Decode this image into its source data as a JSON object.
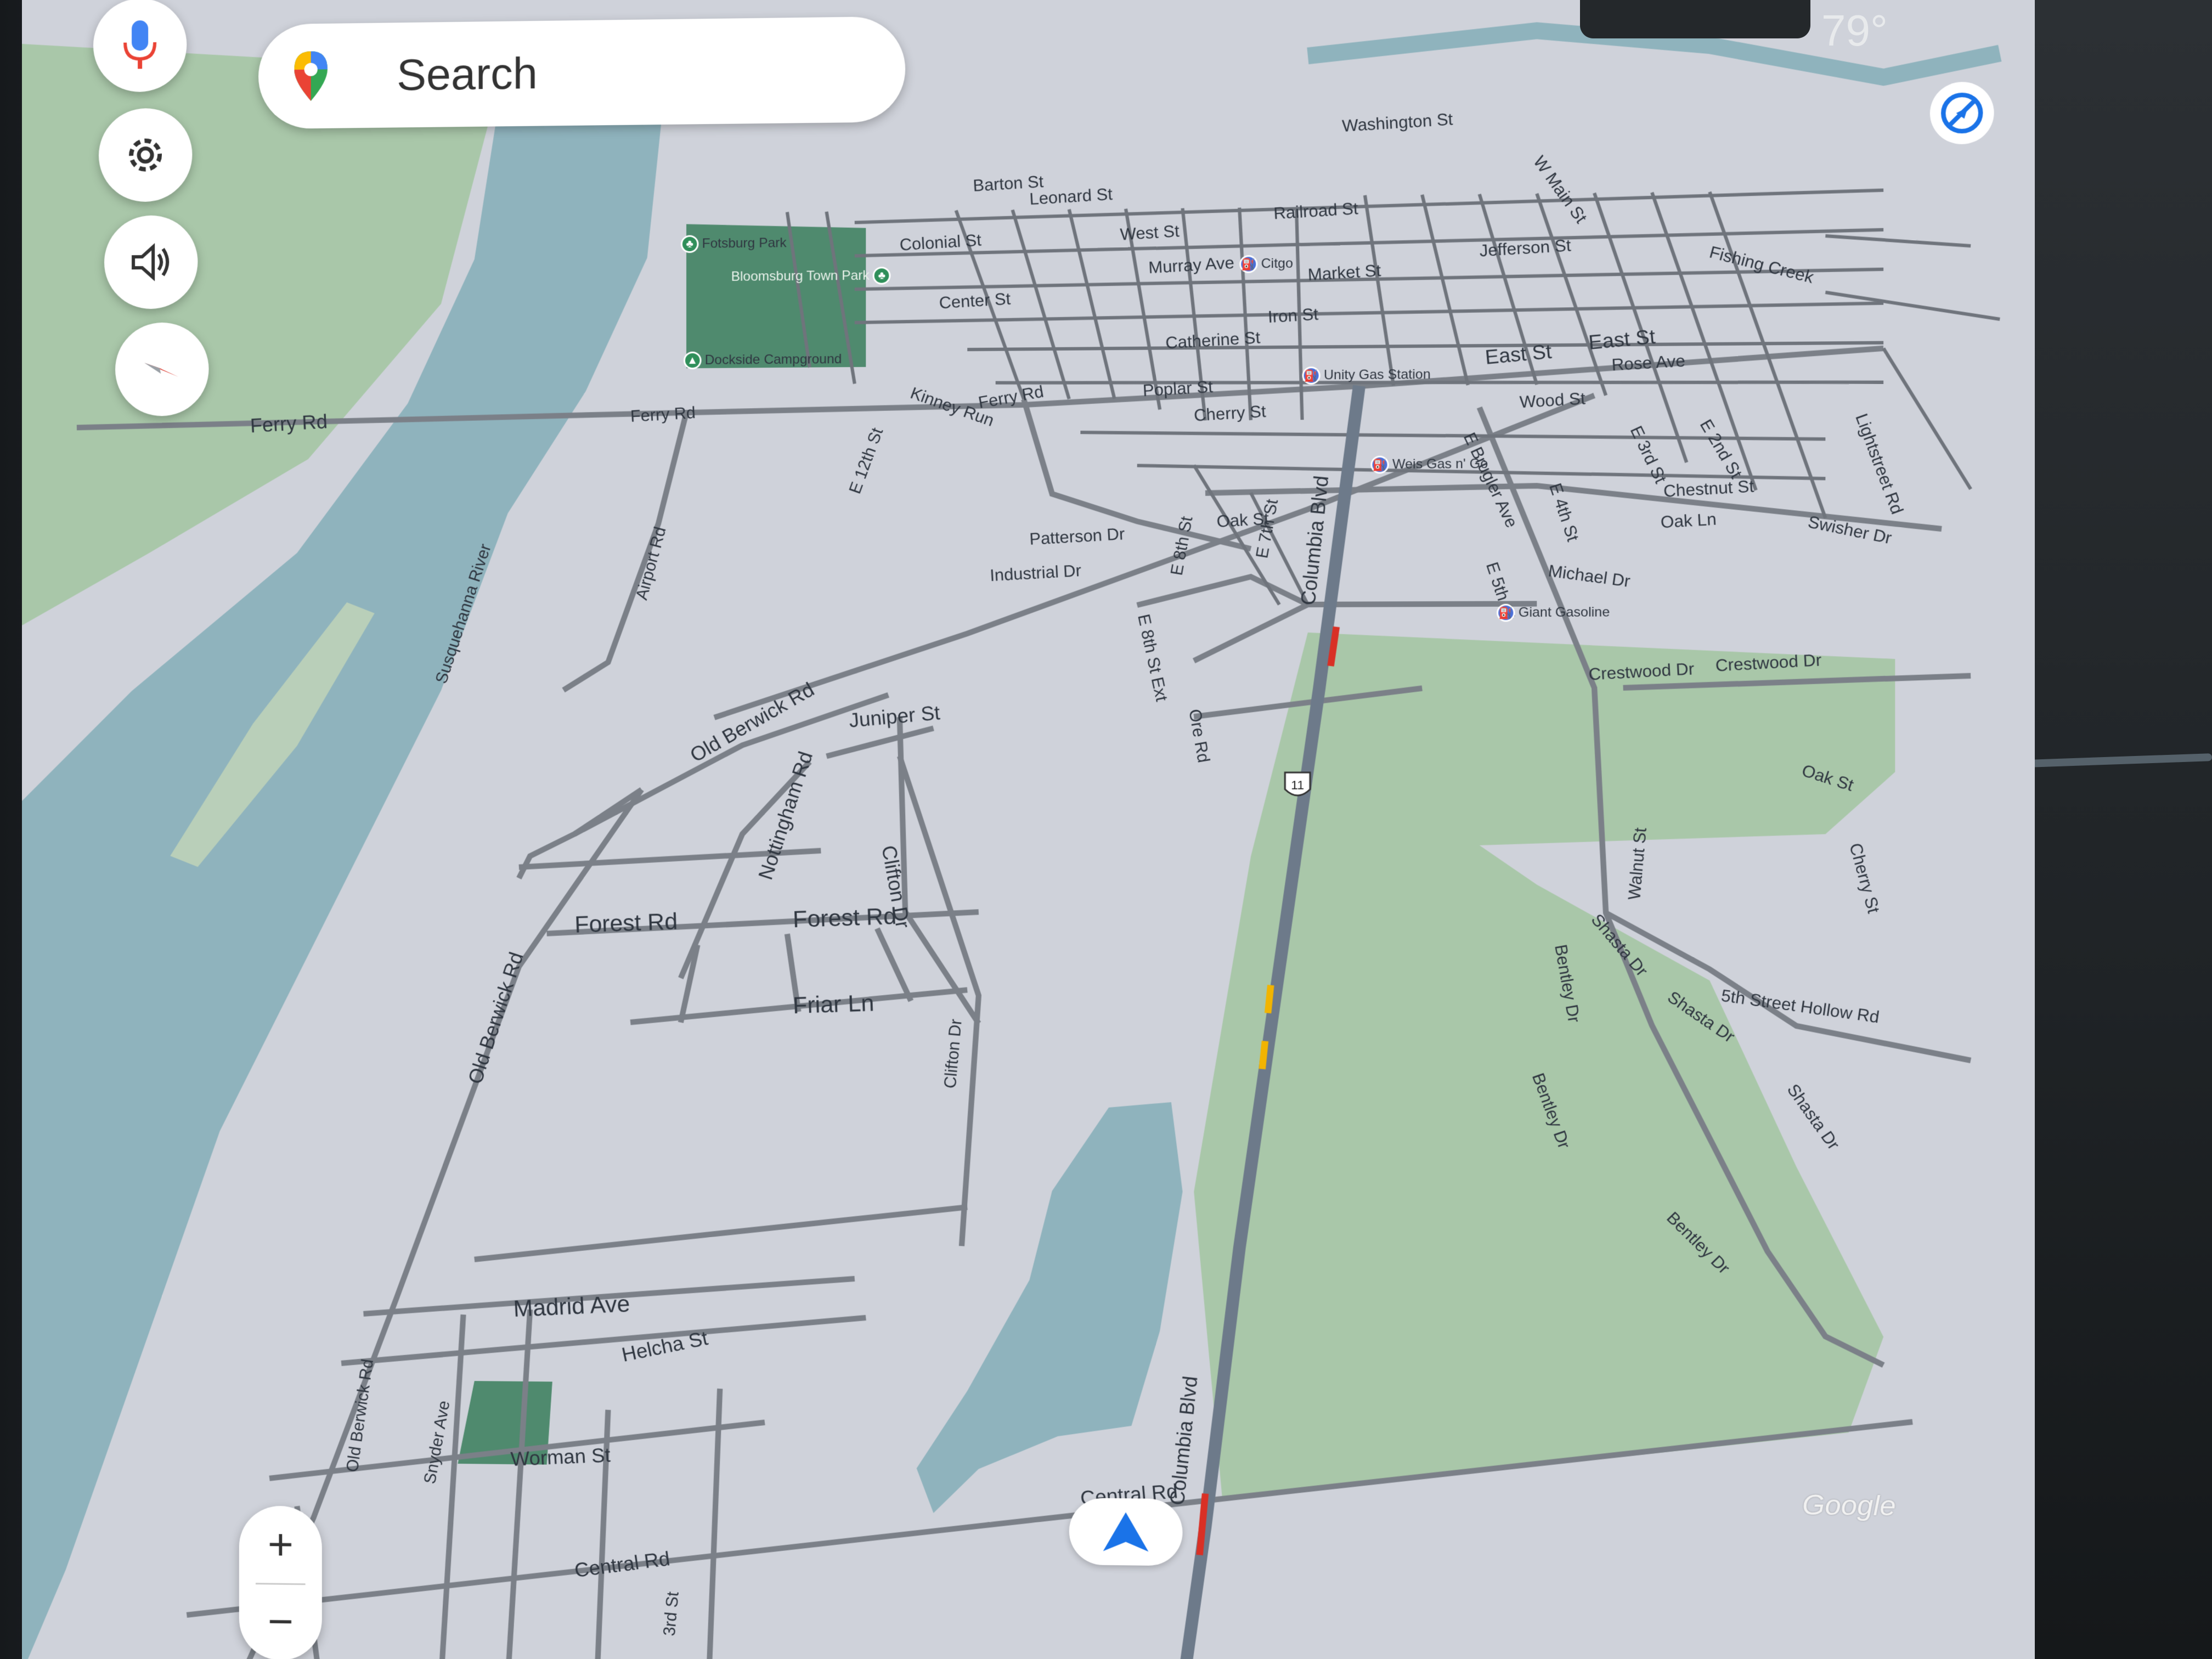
{
  "status": {
    "temperature": "79°"
  },
  "search": {
    "label": "Search"
  },
  "controls": {
    "mic": "mic-icon",
    "settings": "gear-icon",
    "volume": "volume-icon",
    "compass": "compass-icon",
    "zoom_in": "+",
    "zoom_out": "−"
  },
  "attribution": "Google",
  "colors": {
    "land": "#cfd2da",
    "river": "#8fb3bd",
    "park": "#a9c7a9",
    "park_dark": "#4f8a6e",
    "road": "#7b8088",
    "highway": "#6d7a8a",
    "traffic_red": "#d93025",
    "traffic_yellow": "#f2b400",
    "accent_blue": "#1a73e8"
  },
  "streets": {
    "ferry_rd_w": "Ferry Rd",
    "ferry_rd_m": "Ferry Rd",
    "ferry_rd_e": "Ferry Rd",
    "airport_rd": "Airport Rd",
    "susquehanna_river": "Susquehanna River",
    "old_berwick_rd_1": "Old Berwick Rd",
    "old_berwick_rd_2": "Old Berwick Rd",
    "old_berwick_rd_3": "Old Berwick Rd",
    "juniper_st": "Juniper St",
    "nottingham_rd": "Nottingham Rd",
    "clifton_dr_1": "Clifton Dr",
    "clifton_dr_2": "Clifton Dr",
    "forest_rd_1": "Forest Rd",
    "forest_rd_2": "Forest Rd",
    "friar_ln": "Friar Ln",
    "madrid_ave": "Madrid Ave",
    "helcha_st": "Helcha St",
    "snyder_ave": "Snyder Ave",
    "worman_st": "Worman St",
    "central_rd_1": "Central Rd",
    "central_rd_2": "Central Rd",
    "third_st": "3rd St",
    "columbia_blvd_1": "Columbia Blvd",
    "columbia_blvd_2": "Columbia Blvd",
    "ore_rd": "Ore Rd",
    "patterson_dr": "Patterson Dr",
    "industrial_dr": "Industrial Dr",
    "oak_st_1": "Oak St",
    "oak_st_2": "Oak St",
    "poplar_st": "Poplar St",
    "cherry_st_1": "Cherry St",
    "cherry_st_2": "Cherry St",
    "catherine_st": "Catherine St",
    "iron_st": "Iron St",
    "market_st": "Market St",
    "railroad_st": "Railroad St",
    "east_st_1": "East St",
    "east_st_2": "East St",
    "wood_st": "Wood St",
    "michael_dr": "Michael Dr",
    "crestwood_dr_1": "Crestwood Dr",
    "crestwood_dr_2": "Crestwood Dr",
    "walnut_st": "Walnut St",
    "shasta_dr_1": "Shasta Dr",
    "shasta_dr_2": "Shasta Dr",
    "shasta_dr_3": "Shasta Dr",
    "bentley_dr_1": "Bentley Dr",
    "bentley_dr_2": "Bentley Dr",
    "bentley_dr_3": "Bentley Dr",
    "fifth_street_hollow_rd": "5th Street Hollow Rd",
    "chestnut_st": "Chestnut St",
    "oak_ln": "Oak Ln",
    "swisher_dr": "Swisher Dr",
    "lightstreet_rd": "Lightstreet Rd",
    "kinney_run": "Kinney Run",
    "e_12th_st": "E 12th St",
    "colonial_st": "Colonial St",
    "center_st": "Center St",
    "west_st": "West St",
    "murray_ave": "Murray Ave",
    "barton_st": "Barton St",
    "leonard_st": "Leonard St",
    "jefferson_st": "Jefferson St",
    "w_main_st": "W Main St",
    "rose_ave": "Rose Ave",
    "e_5th_st": "E 5th St",
    "e_4th_st": "E 4th St",
    "e_8th_st": "E 8th St",
    "e_7th_st": "E 7th St",
    "e_8th_st_ext": "E 8th St Ext",
    "e_bruger_ave": "E Brugler Ave",
    "e_3rd_st": "E 3rd St",
    "e_2nd_st": "E 2nd St",
    "washington_st": "Washington St",
    "fishing_creek": "Fishing Creek"
  },
  "pois": {
    "fotsburg_park": "Fotsburg Park",
    "bloomsburg_town_park": "Bloomsburg Town Park",
    "dockside_campground": "Dockside Campground",
    "citgo": "Citgo",
    "unity_gas_station": "Unity Gas Station",
    "weis_gas": "Weis Gas n' Go",
    "giant_gasoline": "Giant Gasoline"
  },
  "highway_shield": "11"
}
